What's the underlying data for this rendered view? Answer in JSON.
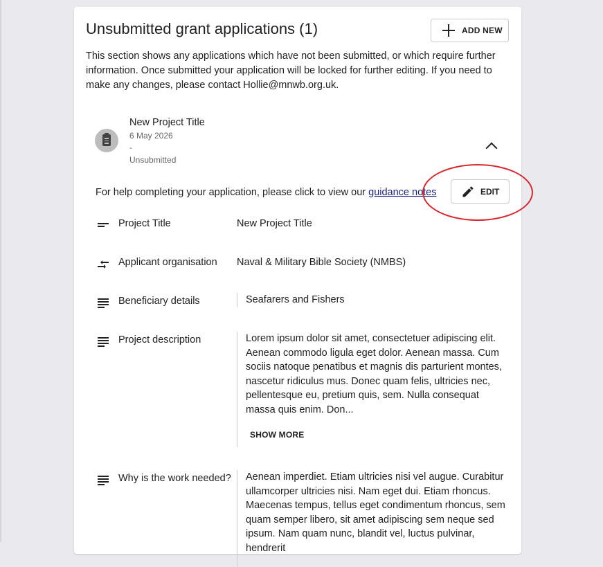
{
  "section": {
    "title": "Unsubmitted grant applications (1)",
    "add_label": "ADD NEW",
    "intro": "This section shows any applications which have not been submitted, or which require further information. Once submitted your application will be locked for further editing. If you need to make any changes, please contact Hollie@mnwb.org.uk."
  },
  "application": {
    "title": "New Project Title",
    "date": "6 May 2026",
    "dash": "-",
    "status": "Unsubmitted",
    "help_text": "For help completing your application, please click to view our ",
    "help_link": "guidance notes",
    "edit_label": "EDIT"
  },
  "fields": [
    {
      "label": "Project Title",
      "value": "New Project Title",
      "icon": "short-text-icon"
    },
    {
      "label": "Applicant organisation",
      "value": "Naval & Military Bible Society (NMBS)",
      "icon": "swap-arrows-icon"
    },
    {
      "label": "Beneficiary details",
      "value": "Seafarers and Fishers",
      "icon": "long-text-icon"
    },
    {
      "label": "Project description",
      "value": "Lorem ipsum dolor sit amet, consectetuer adipiscing elit. Aenean commodo ligula eget dolor. Aenean massa. Cum sociis natoque penatibus et magnis dis parturient montes, nascetur ridiculus mus. Donec quam felis, ultricies nec, pellentesque eu, pretium quis, sem. Nulla consequat massa quis enim. Don...",
      "show_more": "SHOW MORE",
      "icon": "long-text-icon"
    },
    {
      "label": "Why is the work needed?",
      "value": "Aenean imperdiet. Etiam ultricies nisi vel augue. Curabitur ullamcorper ultricies nisi. Nam eget dui. Etiam rhoncus. Maecenas tempus, tellus eget condimentum rhoncus, sem quam semper libero, sit amet adipiscing sem neque sed ipsum. Nam quam nunc, blandit vel, luctus pulvinar, hendrerit",
      "icon": "long-text-icon"
    }
  ],
  "colors": {
    "page_bg": "#e9e9ee",
    "highlight": "#d9262c",
    "link": "#1a237e"
  }
}
